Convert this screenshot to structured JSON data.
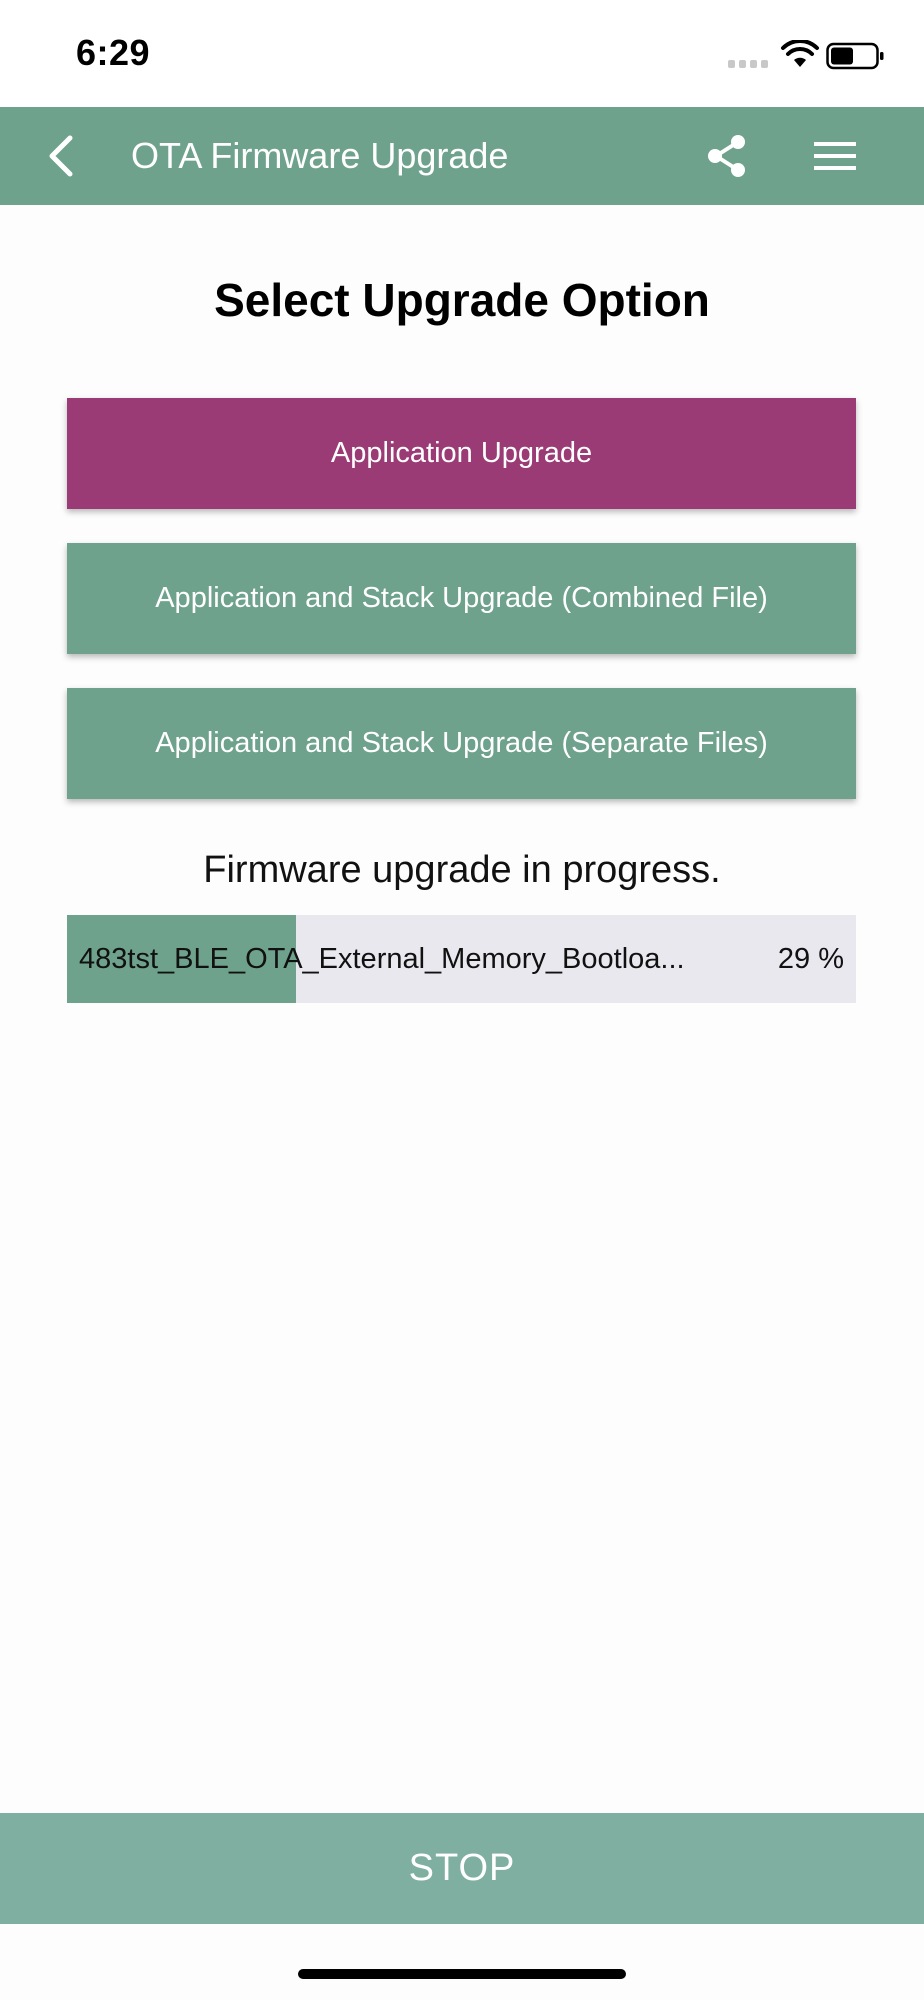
{
  "status_bar": {
    "time": "6:29",
    "icons": [
      "signal-dots-icon",
      "wifi-icon",
      "battery-icon"
    ]
  },
  "nav_bar": {
    "title": "OTA Firmware Upgrade",
    "back_icon": "chevron-left-icon",
    "share_icon": "share-icon",
    "menu_icon": "hamburger-menu-icon",
    "background_color": "#6ea28c"
  },
  "main": {
    "heading": "Select Upgrade Option",
    "options": [
      {
        "label": "Application Upgrade",
        "selected": true,
        "color": "#9b3b75"
      },
      {
        "label": "Application and Stack Upgrade (Combined File)",
        "selected": false,
        "color": "#6ea28c"
      },
      {
        "label": "Application and Stack Upgrade (Separate Files)",
        "selected": false,
        "color": "#6ea28c"
      }
    ],
    "progress": {
      "message": "Firmware upgrade in progress.",
      "filename": "483tst_BLE_OTA_External_Memory_Bootloa...",
      "percent_label": "29 %",
      "percent_value": 29,
      "fill_color": "#6ea28c",
      "track_color": "#e9e8ee"
    }
  },
  "footer": {
    "stop_label": "STOP",
    "stop_color": "#7fafa0"
  }
}
